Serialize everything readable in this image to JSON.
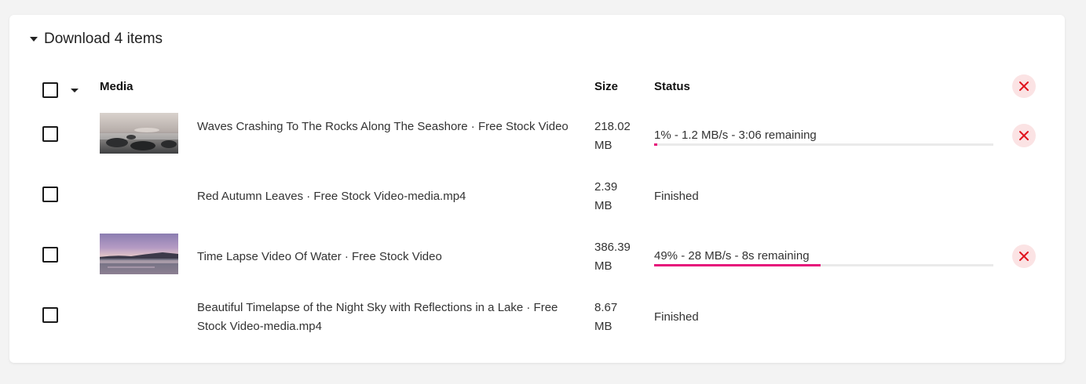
{
  "header": {
    "title": "Download 4 items"
  },
  "table": {
    "columns": {
      "media": "Media",
      "size": "Size",
      "status": "Status"
    }
  },
  "accent_color": "#e6117a",
  "items": [
    {
      "title": "Waves Crashing To The Rocks Along The Seashore · Free Stock Video",
      "size_value": "218.02",
      "size_unit": "MB",
      "status": "1% - 1.2 MB/s - 3:06 remaining",
      "progress": 0.01,
      "thumbnail": "seashore-rocks"
    },
    {
      "title": "Red Autumn Leaves · Free Stock Video-media.mp4",
      "size_value": "2.39",
      "size_unit": "MB",
      "status": "Finished"
    },
    {
      "title": "Time Lapse Video Of Water · Free Stock Video",
      "size_value": "386.39",
      "size_unit": "MB",
      "status": "49% - 28 MB/s - 8s remaining",
      "progress": 0.49,
      "thumbnail": "sunset-water"
    },
    {
      "title": "Beautiful Timelapse of the Night Sky with Reflections in a Lake · Free Stock Video-media.mp4",
      "size_value": "8.67",
      "size_unit": "MB",
      "status": "Finished"
    }
  ]
}
